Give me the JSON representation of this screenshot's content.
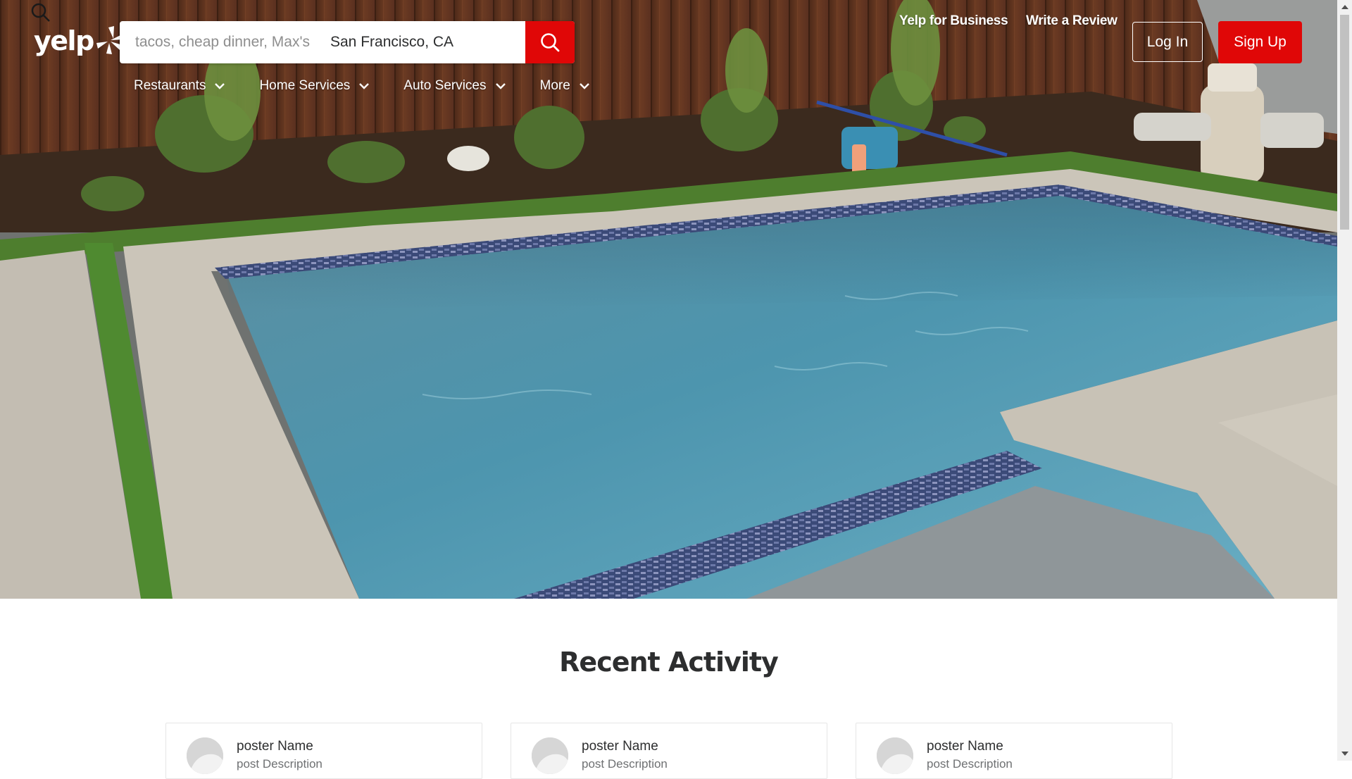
{
  "header": {
    "logo_text": "yelp",
    "search": {
      "find_placeholder": "tacos, cheap dinner, Max's",
      "near_value": "San Francisco, CA"
    },
    "links": {
      "business": "Yelp for Business",
      "write_review": "Write a Review"
    },
    "login_label": "Log In",
    "signup_label": "Sign Up"
  },
  "nav": {
    "items": [
      {
        "label": "Restaurants"
      },
      {
        "label": "Home Services"
      },
      {
        "label": "Auto Services"
      },
      {
        "label": "More"
      }
    ]
  },
  "main": {
    "section_title": "Recent Activity",
    "cards": [
      {
        "poster_name": "poster Name",
        "post_description": "post Description"
      },
      {
        "poster_name": "poster Name",
        "post_description": "post Description"
      },
      {
        "poster_name": "poster Name",
        "post_description": "post Description"
      }
    ]
  },
  "icons": {
    "search": "search-icon",
    "chevron": "chevron-down-icon",
    "logo_burst": "yelp-burst-icon"
  },
  "colors": {
    "brand_red": "#e00707",
    "text_dark": "#2d2e2f",
    "white": "#ffffff"
  }
}
